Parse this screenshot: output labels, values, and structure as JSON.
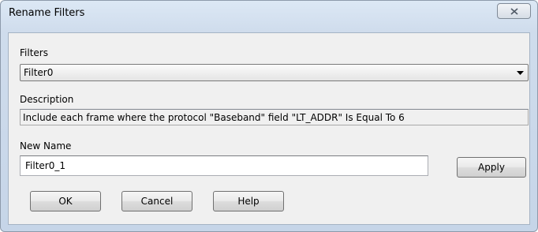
{
  "window": {
    "title": "Rename Filters"
  },
  "filters": {
    "label": "Filters",
    "selected": "Filter0"
  },
  "description": {
    "label": "Description",
    "text": "Include each frame where the protocol \"Baseband\" field \"LT_ADDR\" Is Equal To 6"
  },
  "new_name": {
    "label": "New Name",
    "value": "Filter0_1"
  },
  "buttons": {
    "apply": "Apply",
    "ok": "OK",
    "cancel": "Cancel",
    "help": "Help"
  },
  "icons": {
    "close": "close-icon",
    "dropdown": "chevron-down-icon"
  },
  "colors": {
    "titlebar": "#cfdcec",
    "client_bg": "#f0f0f0"
  }
}
